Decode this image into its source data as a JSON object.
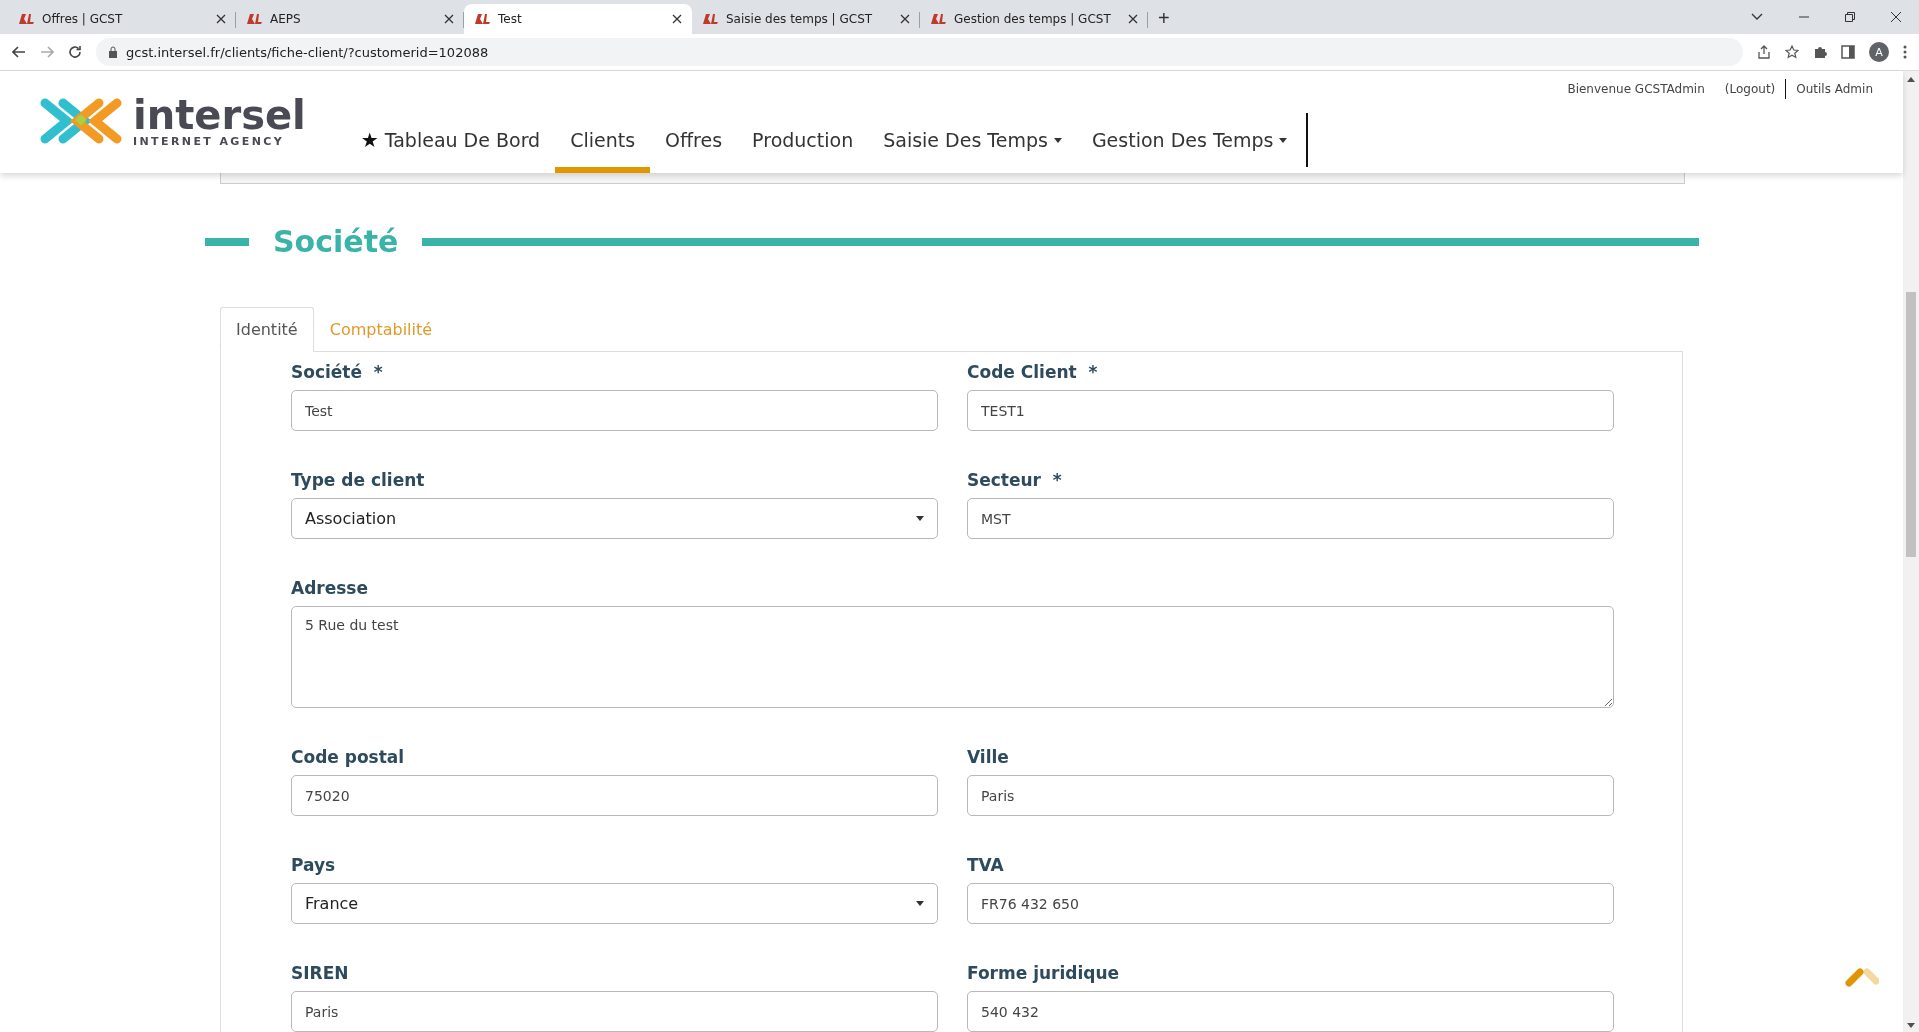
{
  "browser": {
    "tabs": [
      {
        "title": "Offres | GCST",
        "selected": false
      },
      {
        "title": "AEPS",
        "selected": false
      },
      {
        "title": "Test",
        "selected": true
      },
      {
        "title": "Saisie des temps | GCST",
        "selected": false
      },
      {
        "title": "Gestion des temps | GCST",
        "selected": false
      }
    ],
    "new_tab": "+",
    "url": "gcst.intersel.fr/clients/fiche-client/?customerid=102088",
    "profile_initial": "A"
  },
  "header": {
    "logo": {
      "name": "intersel",
      "tagline": "INTERNET AGENCY"
    },
    "user_links": [
      {
        "label": "Bienvenue GCSTAdmin"
      },
      {
        "label": "(Logout)"
      },
      {
        "label": "Outils Admin"
      }
    ],
    "nav": [
      {
        "label": "Tableau De Bord",
        "icon_char": "★",
        "selected": false,
        "dropdown": false
      },
      {
        "label": "Clients",
        "selected": true,
        "dropdown": false
      },
      {
        "label": "Offres",
        "selected": false,
        "dropdown": false
      },
      {
        "label": "Production",
        "selected": false,
        "dropdown": false
      },
      {
        "label": "Saisie Des Temps",
        "selected": false,
        "dropdown": true
      },
      {
        "label": "Gestion Des Temps",
        "selected": false,
        "dropdown": true
      }
    ]
  },
  "section": {
    "title": "Société",
    "tabs": [
      {
        "label": "Identité",
        "selected": true
      },
      {
        "label": "Comptabilité",
        "selected": false
      }
    ],
    "fields": [
      {
        "kind": "text",
        "label": "Société",
        "required_mark": "*",
        "value": "Test"
      },
      {
        "kind": "text",
        "label": "Code Client",
        "required_mark": "*",
        "value": "TEST1"
      },
      {
        "kind": "select",
        "label": "Type de client",
        "value": "Association"
      },
      {
        "kind": "text",
        "label": "Secteur",
        "required_mark": "*",
        "value": "MST"
      },
      {
        "kind": "textarea",
        "label": "Adresse",
        "value": "5 Rue du test"
      },
      {
        "kind": "text",
        "label": "Code postal",
        "value": "75020"
      },
      {
        "kind": "text",
        "label": "Ville",
        "value": "Paris"
      },
      {
        "kind": "select",
        "label": "Pays",
        "value": "France"
      },
      {
        "kind": "text",
        "label": "TVA",
        "value": "FR76 432 650"
      },
      {
        "kind": "text",
        "label": "SIREN",
        "value": "Paris"
      },
      {
        "kind": "text",
        "label": "Forme juridique",
        "value": "540 432"
      }
    ]
  }
}
